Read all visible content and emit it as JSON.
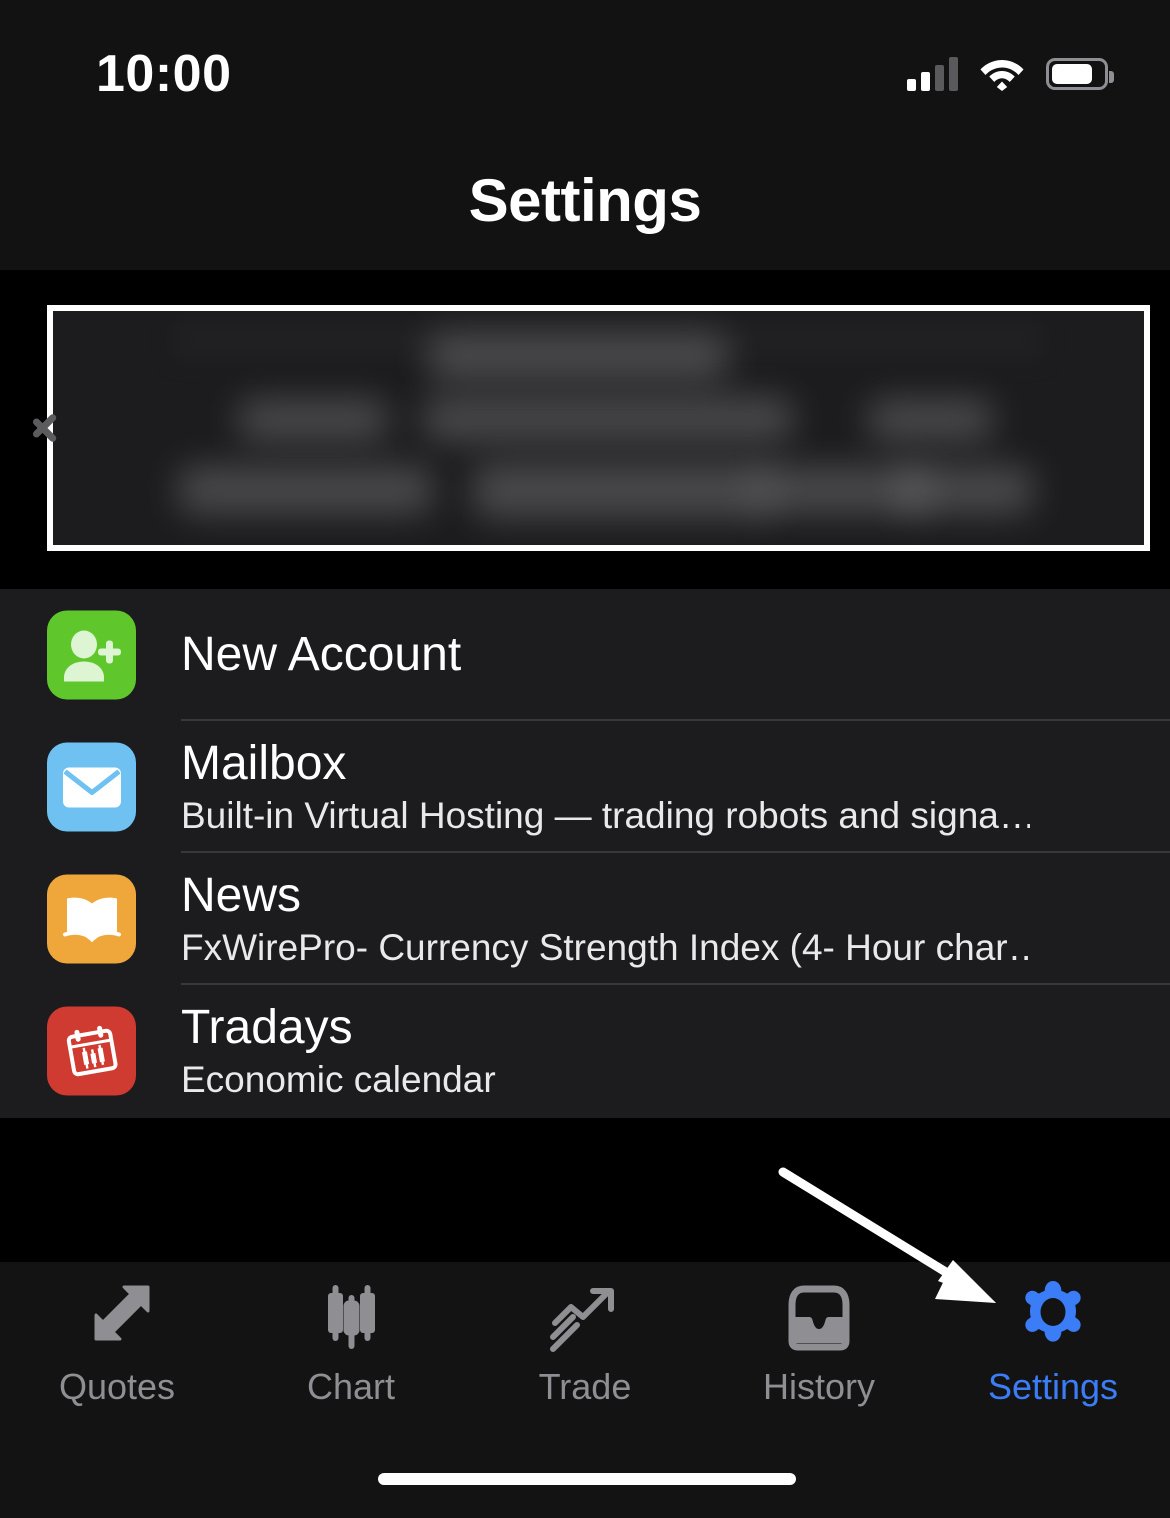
{
  "status_bar": {
    "time": "10:00",
    "signal_icon": "cellular-signal-icon",
    "signal_bars_active": 2,
    "signal_bars_total": 4,
    "wifi_icon": "wifi-icon",
    "battery_icon": "battery-icon",
    "battery_level_percent": 72
  },
  "header": {
    "title": "Settings"
  },
  "account_card": {
    "name": "account-card",
    "content_state": "blurred",
    "chevron_icon": "chevron-right-icon",
    "highlighted": true,
    "highlight_color": "#ffffff"
  },
  "list": {
    "items": [
      {
        "title": "New Account",
        "subtitle": "",
        "icon": "person-add-icon",
        "icon_color": "#5FC72C",
        "chevron_icon": "chevron-right-icon"
      },
      {
        "title": "Mailbox",
        "subtitle": "Built-in Virtual Hosting — trading robots and signa…",
        "icon": "envelope-icon",
        "icon_color": "#6EC1F0",
        "chevron_icon": "chevron-right-icon"
      },
      {
        "title": "News",
        "subtitle": "FxWirePro- Currency Strength Index (4- Hour char…",
        "icon": "open-book-icon",
        "icon_color": "#EFA73C",
        "chevron_icon": "chevron-right-icon"
      },
      {
        "title": "Tradays",
        "subtitle": "Economic calendar",
        "icon": "calendar-candlestick-icon",
        "icon_color": "#CF3A31",
        "chevron_icon": "chevron-right-icon"
      }
    ]
  },
  "tab_bar": {
    "active_color": "#3b7df7",
    "inactive_color": "#8e8e93",
    "tabs": [
      {
        "label": "Quotes",
        "icon": "double-arrow-icon",
        "active": false
      },
      {
        "label": "Chart",
        "icon": "candlestick-icon",
        "active": false
      },
      {
        "label": "Trade",
        "icon": "trend-up-icon",
        "active": false
      },
      {
        "label": "History",
        "icon": "inbox-tray-icon",
        "active": false
      },
      {
        "label": "Settings",
        "icon": "gear-icon",
        "active": true
      }
    ]
  },
  "annotation": {
    "arrow_icon": "pointer-arrow-icon",
    "color": "#ffffff",
    "points_to": "Settings"
  }
}
